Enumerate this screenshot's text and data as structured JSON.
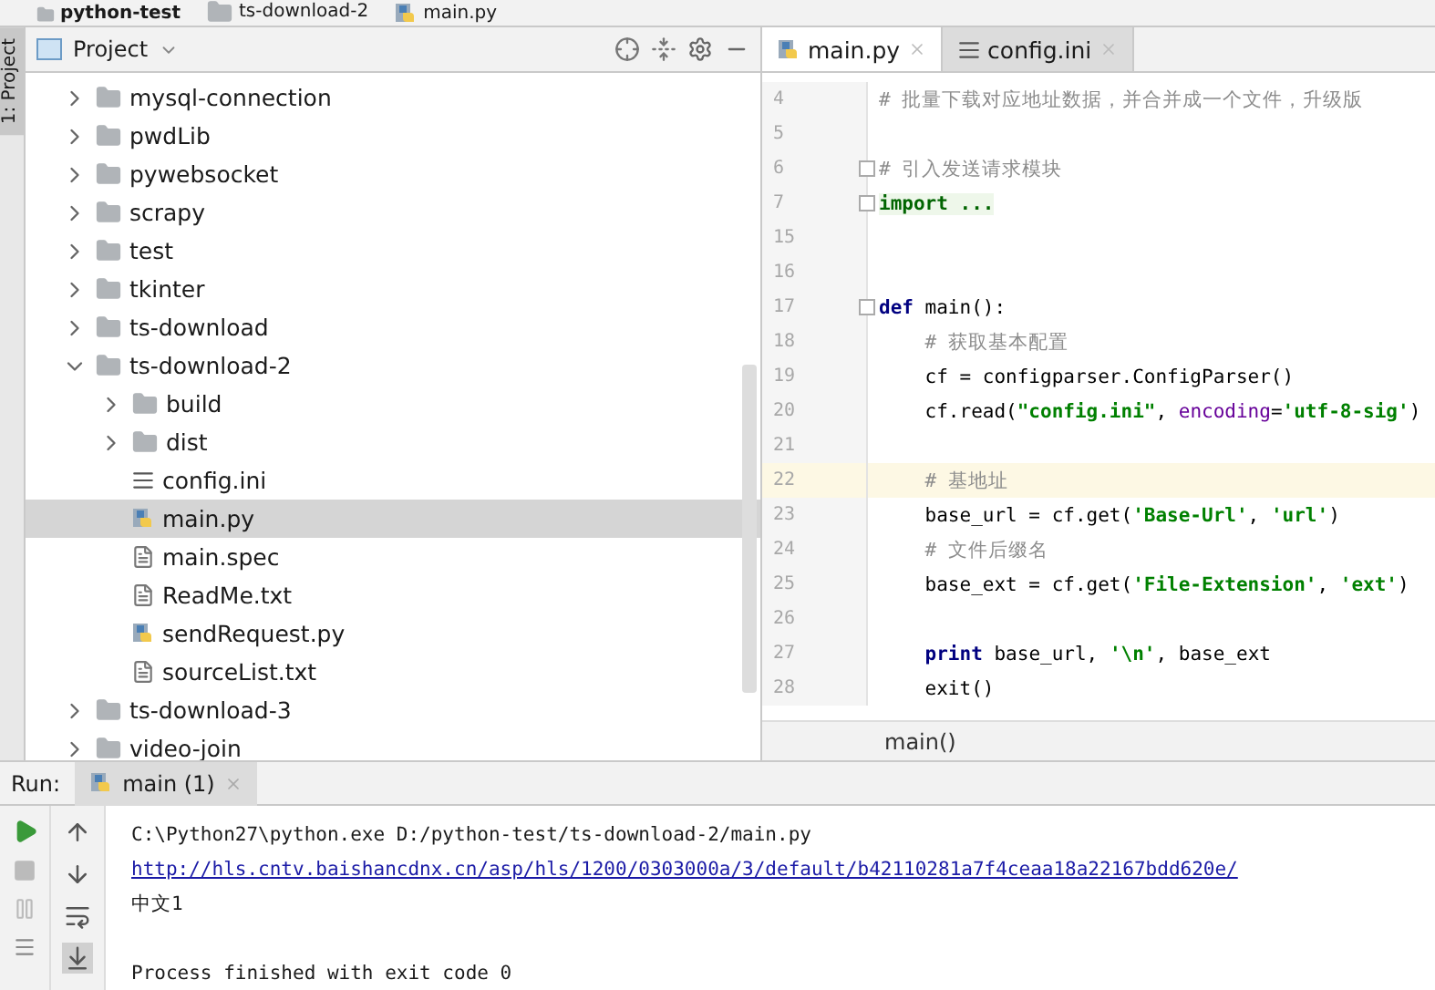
{
  "breadcrumbs": [
    {
      "label": "python-test",
      "kind": "project"
    },
    {
      "label": "ts-download-2",
      "kind": "folder"
    },
    {
      "label": "main.py",
      "kind": "python"
    }
  ],
  "side_stripe": {
    "label": "1: Project",
    "selected": true
  },
  "project_panel": {
    "title": "Project",
    "tree": [
      {
        "label": "mysql-connection",
        "kind": "folder",
        "expanded": false,
        "selected": false
      },
      {
        "label": "pwdLib",
        "kind": "folder",
        "expanded": false,
        "selected": false
      },
      {
        "label": "pywebsocket",
        "kind": "folder",
        "expanded": false,
        "selected": false
      },
      {
        "label": "scrapy",
        "kind": "folder",
        "expanded": false,
        "selected": false
      },
      {
        "label": "test",
        "kind": "folder",
        "expanded": false,
        "selected": false
      },
      {
        "label": "tkinter",
        "kind": "folder",
        "expanded": false,
        "selected": false
      },
      {
        "label": "ts-download",
        "kind": "folder",
        "expanded": false,
        "selected": false
      },
      {
        "label": "ts-download-2",
        "kind": "folder",
        "expanded": true,
        "selected": false,
        "children": [
          {
            "label": "build",
            "kind": "folder",
            "expanded": false,
            "selected": false
          },
          {
            "label": "dist",
            "kind": "folder",
            "expanded": false,
            "selected": false
          },
          {
            "label": "config.ini",
            "kind": "config",
            "selected": false
          },
          {
            "label": "main.py",
            "kind": "python",
            "selected": true
          },
          {
            "label": "main.spec",
            "kind": "text",
            "selected": false
          },
          {
            "label": "ReadMe.txt",
            "kind": "text",
            "selected": false
          },
          {
            "label": "sendRequest.py",
            "kind": "python",
            "selected": false
          },
          {
            "label": "sourceList.txt",
            "kind": "text",
            "selected": false
          }
        ]
      },
      {
        "label": "ts-download-3",
        "kind": "folder",
        "expanded": false,
        "selected": false
      },
      {
        "label": "video-join",
        "kind": "folder",
        "expanded": false,
        "selected": false
      }
    ]
  },
  "editor": {
    "tabs": [
      {
        "label": "main.py",
        "kind": "python",
        "selected": true
      },
      {
        "label": "config.ini",
        "kind": "config",
        "selected": false
      }
    ],
    "lines": [
      {
        "number": "4",
        "fold": false,
        "current": false,
        "tokens": [
          {
            "kind": "comment",
            "text": "# 批量下载对应地址数据，并合并成一个文件，升级版"
          }
        ]
      },
      {
        "number": "5",
        "fold": false,
        "current": false
      },
      {
        "number": "6",
        "fold": true,
        "current": false,
        "tokens": [
          {
            "kind": "comment",
            "text": "# 引入发送请求模块"
          }
        ]
      },
      {
        "number": "7",
        "fold": true,
        "current": false,
        "tokens": [
          {
            "kind": "folded",
            "text": "import ..."
          }
        ]
      },
      {
        "number": "15",
        "fold": false,
        "current": false
      },
      {
        "number": "16",
        "fold": false,
        "current": false
      },
      {
        "number": "17",
        "fold": true,
        "current": false,
        "tokens": [
          {
            "kind": "keyword",
            "text": "def"
          },
          {
            "kind": "plain",
            "text": " main():"
          }
        ]
      },
      {
        "number": "18",
        "fold": false,
        "current": false,
        "tokens": [
          {
            "kind": "comment",
            "text": "    # 获取基本配置"
          }
        ]
      },
      {
        "number": "19",
        "fold": false,
        "current": false,
        "tokens": [
          {
            "kind": "plain",
            "text": "    cf = configparser.ConfigParser()"
          }
        ]
      },
      {
        "number": "20",
        "fold": false,
        "current": false,
        "tokens": [
          {
            "kind": "plain",
            "text": "    cf.read("
          },
          {
            "kind": "string",
            "text": "\"config.ini\""
          },
          {
            "kind": "plain",
            "text": ", "
          },
          {
            "kind": "param",
            "text": "encoding"
          },
          {
            "kind": "plain",
            "text": "="
          },
          {
            "kind": "string",
            "text": "'utf-8-sig'"
          },
          {
            "kind": "plain",
            "text": ")"
          }
        ]
      },
      {
        "number": "21",
        "fold": false,
        "current": false
      },
      {
        "number": "22",
        "fold": false,
        "current": true,
        "tokens": [
          {
            "kind": "comment",
            "text": "    # 基地址"
          }
        ]
      },
      {
        "number": "23",
        "fold": false,
        "current": false,
        "tokens": [
          {
            "kind": "plain",
            "text": "    base_url = cf.get("
          },
          {
            "kind": "string",
            "text": "'Base-Url'"
          },
          {
            "kind": "plain",
            "text": ", "
          },
          {
            "kind": "string",
            "text": "'url'"
          },
          {
            "kind": "plain",
            "text": ")"
          }
        ]
      },
      {
        "number": "24",
        "fold": false,
        "current": false,
        "tokens": [
          {
            "kind": "comment",
            "text": "    # 文件后缀名"
          }
        ]
      },
      {
        "number": "25",
        "fold": false,
        "current": false,
        "tokens": [
          {
            "kind": "plain",
            "text": "    base_ext = cf.get("
          },
          {
            "kind": "string",
            "text": "'File-Extension'"
          },
          {
            "kind": "plain",
            "text": ", "
          },
          {
            "kind": "string",
            "text": "'ext'"
          },
          {
            "kind": "plain",
            "text": ")"
          }
        ]
      },
      {
        "number": "26",
        "fold": false,
        "current": false
      },
      {
        "number": "27",
        "fold": false,
        "current": false,
        "tokens": [
          {
            "kind": "keyword",
            "text": "    print"
          },
          {
            "kind": "plain",
            "text": " base_url, "
          },
          {
            "kind": "string",
            "text": "'\\n'"
          },
          {
            "kind": "plain",
            "text": ", base_ext"
          }
        ]
      },
      {
        "number": "28",
        "fold": false,
        "current": false,
        "tokens": [
          {
            "kind": "plain",
            "text": "    exit()"
          }
        ]
      }
    ],
    "breadcrumb": "main()"
  },
  "run_panel": {
    "label": "Run:",
    "tabs": [
      {
        "label": "main (1)",
        "selected": true
      }
    ],
    "console": [
      {
        "kind": "plain",
        "text": "C:\\Python27\\python.exe D:/python-test/ts-download-2/main.py"
      },
      {
        "kind": "link",
        "text": "http://hls.cntv.baishancdnx.cn/asp/hls/1200/0303000a/3/default/b42110281a7f4ceaa18a22167bdd620e/"
      },
      {
        "kind": "plain",
        "text": "中文1"
      },
      {
        "kind": "blank"
      },
      {
        "kind": "plain",
        "text": "Process finished with exit code 0"
      }
    ]
  }
}
